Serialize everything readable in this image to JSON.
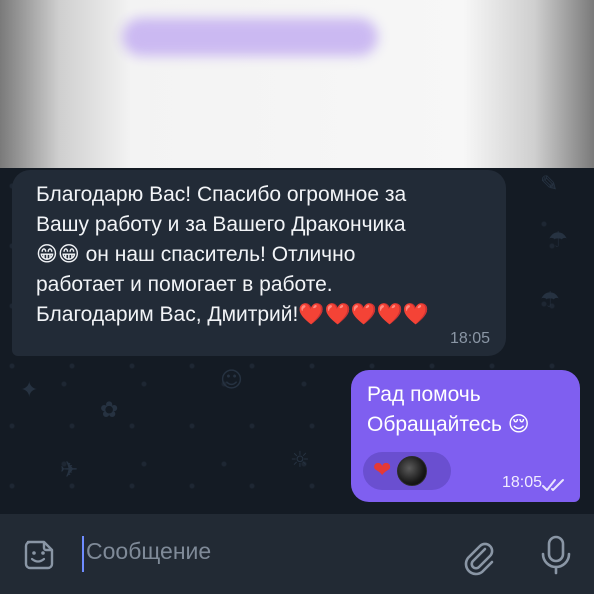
{
  "incoming_message": {
    "lines": [
      "Благодарю Вас!  Спасибо огромное за",
      "Вашу работу и за Вашего Дракончика",
      "😁😁 он наш спаситель! Отлично",
      "работает и помогает в работе.",
      "Благодарим Вас, Дмитрий!❤️❤️❤️❤️❤️"
    ],
    "time": "18:05"
  },
  "outgoing_message": {
    "lines": [
      "Рад помочь",
      "Обращайтесь 😌"
    ],
    "time": "18:05",
    "reactions": [
      {
        "icon": "red-heart"
      },
      {
        "icon": "user-avatar"
      }
    ],
    "status_icon": "double-check"
  },
  "composer": {
    "placeholder": "Сообщение",
    "emoji_icon": "sticker-emoji-icon",
    "attach_icon": "paperclip-icon",
    "mic_icon": "microphone-icon"
  },
  "colors": {
    "background": "#141b24",
    "incoming_bubble": "#222b37",
    "outgoing_bubble": "#7f5ff0",
    "input_bar": "#222a34",
    "caret": "#6f8cff"
  }
}
